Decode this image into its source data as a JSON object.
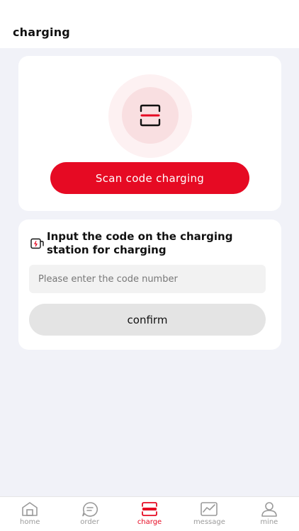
{
  "header": {
    "title": "charging"
  },
  "scan": {
    "icon": "scan-icon",
    "button_label": "Scan code charging"
  },
  "code": {
    "icon": "charging-station-icon",
    "title": "Input the code on the charging station for charging",
    "input_value": "",
    "input_placeholder": "Please enter the code number",
    "confirm_label": "confirm"
  },
  "tabbar": {
    "items": [
      {
        "label": "home",
        "icon": "home-icon"
      },
      {
        "label": "order",
        "icon": "order-icon"
      },
      {
        "label": "charge",
        "icon": "charge-scan-icon",
        "active": true
      },
      {
        "label": "message",
        "icon": "message-icon"
      },
      {
        "label": "mine",
        "icon": "person-icon"
      }
    ]
  },
  "colors": {
    "accent": "#e60a23",
    "background": "#f1f2f8",
    "inactive": "#9a9a9a"
  }
}
